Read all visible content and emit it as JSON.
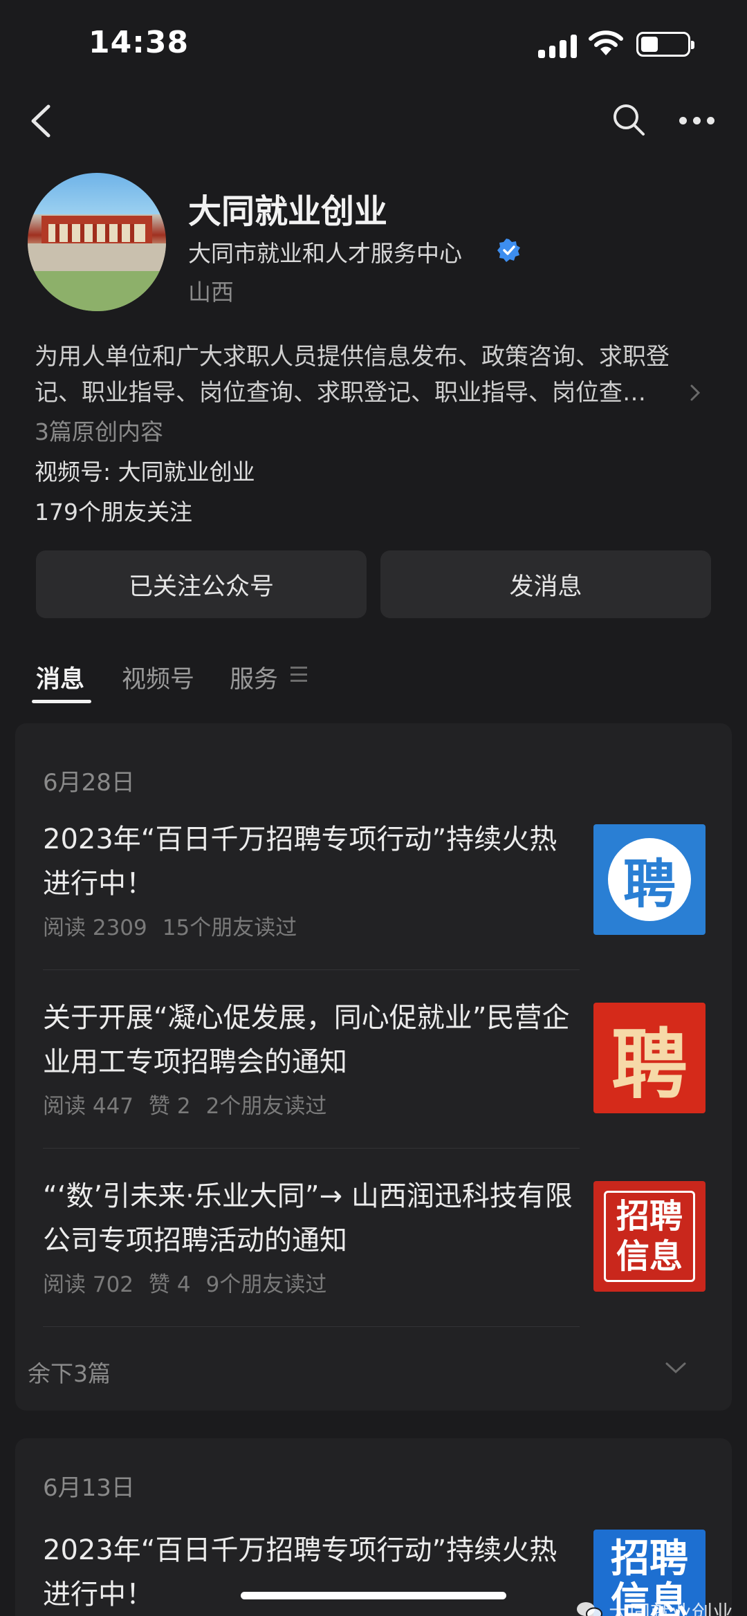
{
  "status_bar": {
    "time": "14:38"
  },
  "profile": {
    "name": "大同就业创业",
    "org": "大同市就业和人才服务中心",
    "location": "山西",
    "description_line1": "为用人单位和广大求职人员提供信息发布、政策咨询、求职登",
    "description_line2": "记、职业指导、岗位查询、求职登记、职业指导、岗位查…",
    "original_count": "3篇原创内容",
    "channel": "视频号: 大同就业创业",
    "friends": "179个朋友关注"
  },
  "buttons": {
    "followed": "已关注公众号",
    "message": "发消息"
  },
  "tabs": [
    {
      "label": "消息"
    },
    {
      "label": "视频号"
    },
    {
      "label": "服务"
    }
  ],
  "feed": [
    {
      "date": "6月28日",
      "articles": [
        {
          "title": "2023年“百日千万招聘专项行动”持续火热进行中！",
          "reads": "阅读 2309",
          "likes": "",
          "friends": "15个朋友读过",
          "thumb_text": "聘"
        },
        {
          "title": "关于开展“凝心促发展，同心促就业”民营企业用工专项招聘会的通知",
          "reads": "阅读 447",
          "likes": "赞 2",
          "friends": "2个朋友读过",
          "thumb_text": "聘"
        },
        {
          "title": "“‘数’引未来·乐业大同”→ 山西润迅科技有限公司专项招聘活动的通知",
          "reads": "阅读 702",
          "likes": "赞 4",
          "friends": "9个朋友读过",
          "thumb_text_1": "招聘",
          "thumb_text_2": "信息"
        }
      ],
      "remaining": "余下3篇"
    },
    {
      "date": "6月13日",
      "articles": [
        {
          "title": "2023年“百日千万招聘专项行动”持续火热进行中！",
          "thumb_text_1": "招聘",
          "thumb_text_2": "信息"
        }
      ]
    }
  ],
  "watermark": "大同就业创业",
  "colors": {
    "background": "#1b1b1d",
    "card": "#222224",
    "verified": "#3d8ef0",
    "thumb_blue": "#2a7fd4",
    "thumb_red": "#d52a1a"
  },
  "icons": [
    "back-icon",
    "search-icon",
    "more-icon",
    "verified-icon",
    "chevron-right-icon",
    "menu-icon",
    "chevron-down-icon",
    "wechat-icon"
  ]
}
